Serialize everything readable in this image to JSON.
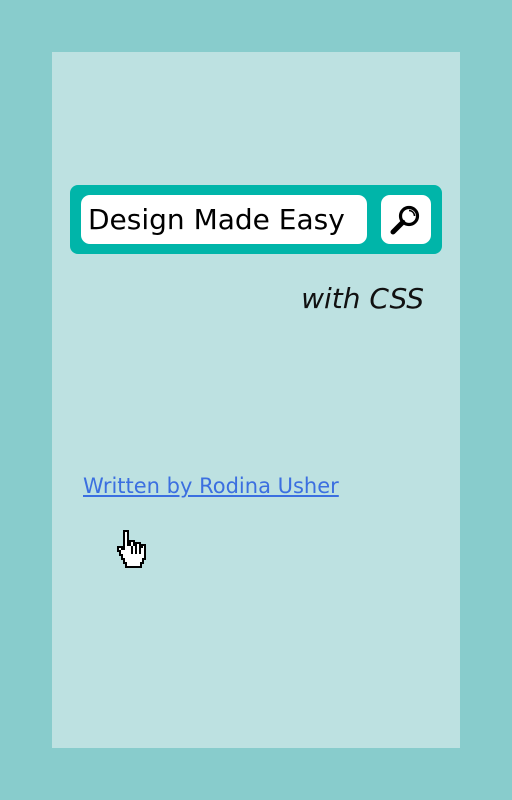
{
  "search": {
    "value": "Design Made Easy",
    "button_icon": "magnifier-icon"
  },
  "subtitle": "with CSS",
  "author_link": "Written by Rodina Usher",
  "cursor_icon": "hand-pointer-icon",
  "colors": {
    "outer_background": "#88cccc",
    "panel_background": "#bde1e1",
    "search_bar": "#00b5a9",
    "link": "#3b6fe0"
  }
}
